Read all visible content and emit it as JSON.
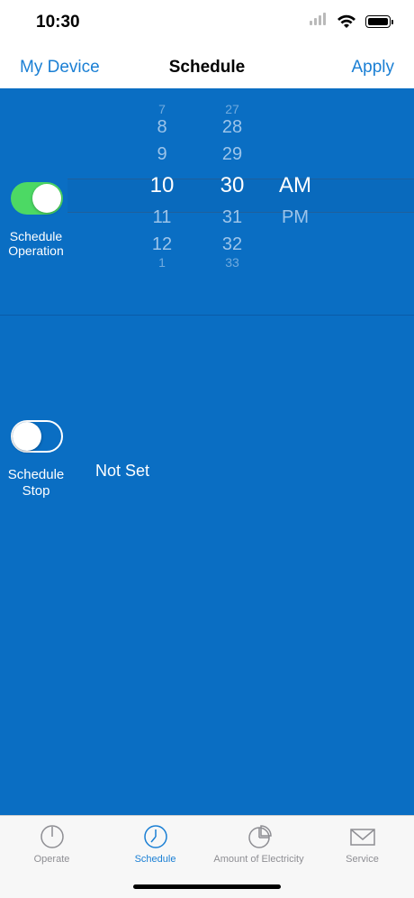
{
  "status_bar": {
    "time": "10:30"
  },
  "nav": {
    "back_label": "My Device",
    "title": "Schedule",
    "apply_label": "Apply"
  },
  "schedule_operation": {
    "label_line1": "Schedule",
    "label_line2": "Operation",
    "enabled": true,
    "picker": {
      "hours": {
        "above": [
          "7",
          "8",
          "9"
        ],
        "selected": "10",
        "below": [
          "11",
          "12",
          "1"
        ]
      },
      "minutes": {
        "above": [
          "27",
          "28",
          "29"
        ],
        "selected": "30",
        "below": [
          "31",
          "32",
          "33"
        ]
      },
      "ampm": {
        "selected": "AM",
        "below": [
          "PM"
        ]
      }
    }
  },
  "schedule_stop": {
    "label_line1": "Schedule",
    "label_line2": "Stop",
    "enabled": false,
    "value": "Not Set"
  },
  "tabs": [
    {
      "label": "Operate",
      "icon": "power-icon",
      "active": false
    },
    {
      "label": "Schedule",
      "icon": "clock-icon",
      "active": true
    },
    {
      "label": "Amount of Electricity",
      "icon": "pie-chart-icon",
      "active": false
    },
    {
      "label": "Service",
      "icon": "envelope-icon",
      "active": false
    }
  ],
  "colors": {
    "accent": "#1a7fd4",
    "background": "#0a6ec3",
    "toggle_on": "#4cd964"
  }
}
